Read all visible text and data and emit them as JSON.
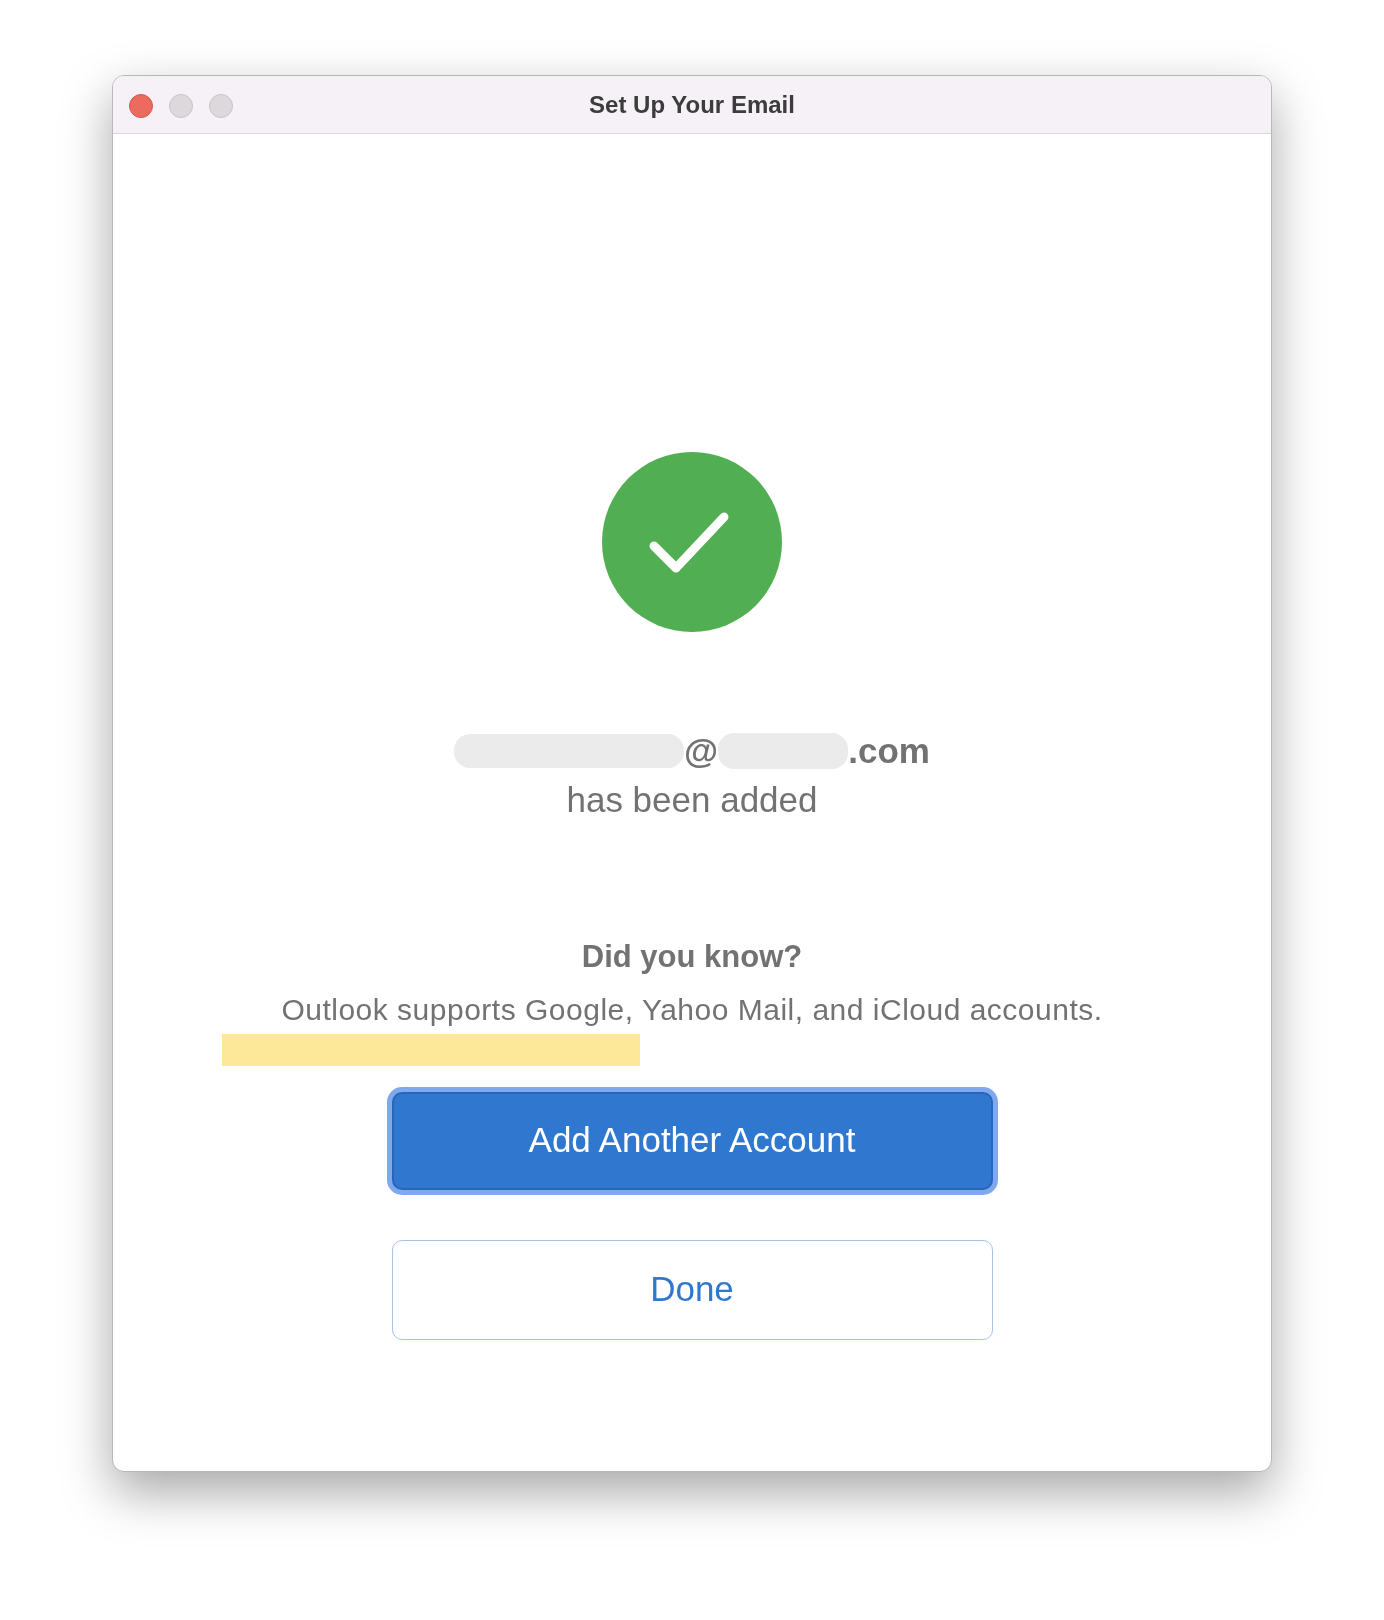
{
  "window": {
    "title": "Set Up Your Email"
  },
  "email": {
    "visible_parts": [
      "@",
      ".com"
    ]
  },
  "message": "has been added",
  "tip": {
    "heading": "Did you know?",
    "text": "Outlook supports Google, Yahoo Mail, and iCloud accounts."
  },
  "buttons": [
    {
      "label": "Add Another Account",
      "kind": "primary",
      "focused": true
    },
    {
      "label": "Done",
      "kind": "secondary",
      "focused": false
    }
  ]
}
